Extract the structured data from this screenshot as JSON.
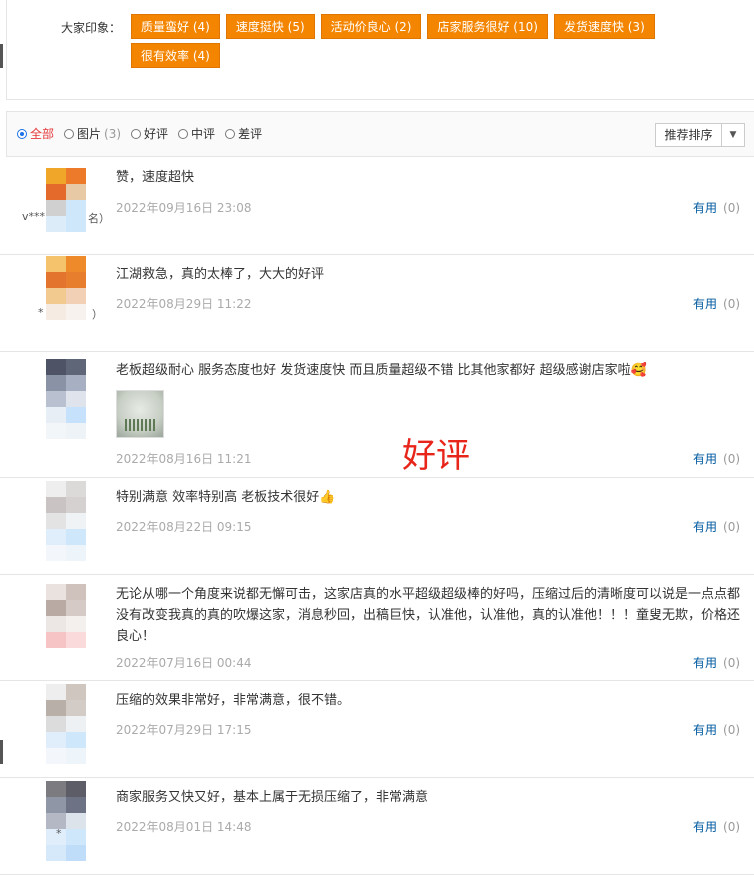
{
  "impressions": {
    "label": "大家印象：",
    "tags": [
      "质量蛮好 (4)",
      "速度挺快 (5)",
      "活动价良心 (2)",
      "店家服务很好 (10)",
      "发货速度快 (3)",
      "很有效率 (4)"
    ]
  },
  "filter": {
    "options": [
      {
        "label": "全部",
        "count": ""
      },
      {
        "label": "图片",
        "count": "(3)"
      },
      {
        "label": "好评",
        "count": ""
      },
      {
        "label": "中评",
        "count": ""
      },
      {
        "label": "差评",
        "count": ""
      }
    ],
    "selected": "全部",
    "sort_label": "推荐排序"
  },
  "reviews": [
    {
      "user": "v***",
      "user_tail": "名）",
      "text": "赞，速度超快",
      "date": "2022年09月16日 23:08",
      "useful_label": "有用",
      "useful_count": "(0)",
      "avatar_colors": [
        "#f0a628",
        "#ec7a2a",
        "#e46a2c",
        "#e8c9a6",
        "#d0d0d0",
        "#cfe7fb"
      ]
    },
    {
      "user": "*",
      "user_tail": "）",
      "text": "江湖救急，真的太棒了，大大的好评",
      "date": "2022年08月29日 11:22",
      "useful_label": "有用",
      "useful_count": "(0)",
      "avatar_colors": [
        "#f4c36b",
        "#ee8a2a",
        "#e3742d",
        "#f2c98f",
        "#f1d0b6",
        "#f5ebe2"
      ]
    },
    {
      "user": "",
      "user_tail": "",
      "text": "老板超级耐心 服务态度也好 发货速度快 而且质量超级不错 比其他家都好 超级感谢店家啦",
      "emoji": "🥰",
      "date": "2022年08月16日 11:21",
      "useful_label": "有用",
      "useful_count": "(0)",
      "avatar_colors": [
        "#4e5366",
        "#5f6678",
        "#8a92a6",
        "#a7afc2",
        "#dfe4ec",
        "#c6e1fb"
      ]
    },
    {
      "user": "",
      "user_tail": "",
      "text": "特别满意 效率特别高 老板技术很好",
      "emoji": "👍",
      "date": "2022年08月22日 09:15",
      "useful_label": "有用",
      "useful_count": "(0)",
      "avatar_colors": [
        "#eeeeee",
        "#dcd9d9",
        "#c9c3c3",
        "#e3e3e3",
        "#eff3f6",
        "#cfe7fb"
      ]
    },
    {
      "user": "",
      "user_tail": "",
      "text": "无论从哪一个角度来说都无懈可击，这家店真的水平超级超级棒的好吗，压缩过后的清晰度可以说是一点点都没有改变我真的真的吹爆这家，消息秒回，出稿巨快，认准他，认准他，真的认准他！！！童叟无欺，价格还良心！",
      "date": "2022年07月16日 00:44",
      "useful_label": "有用",
      "useful_count": "(0)",
      "avatar_colors": [
        "#e9e2de",
        "#cfc1bb",
        "#b9aaa4",
        "#ece7e4",
        "#f4f0ee",
        "#f7c4c6"
      ]
    },
    {
      "user": "",
      "user_tail": "",
      "text": "压缩的效果非常好，非常满意，很不错。",
      "date": "2022年07月29日 17:15",
      "useful_label": "有用",
      "useful_count": "(0)",
      "avatar_colors": [
        "#eeeeee",
        "#cfc6bf",
        "#b8afa8",
        "#dcdcdc",
        "#eef1f3",
        "#cfe7fb"
      ]
    },
    {
      "user": "*",
      "user_tail": "",
      "text": "商家服务又快又好，基本上属于无损压缩了，非常满意",
      "date": "2022年08月01日 14:48",
      "useful_label": "有用",
      "useful_count": "(0)",
      "avatar_colors": [
        "#7c7c80",
        "#5c5d66",
        "#8f96a6",
        "#b4b8c4",
        "#dde3ea",
        "#cfe7fb"
      ]
    }
  ],
  "overlay_text": "好评"
}
